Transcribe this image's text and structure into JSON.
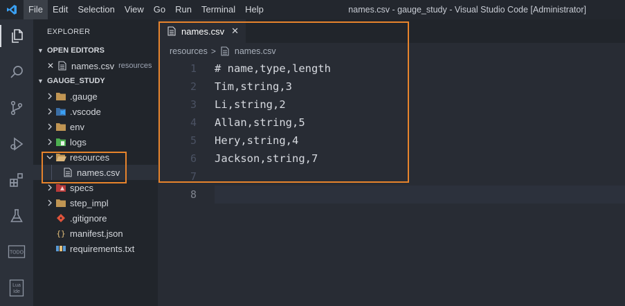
{
  "window": {
    "title": "names.csv - gauge_study - Visual Studio Code [Administrator]",
    "menu": [
      "File",
      "Edit",
      "Selection",
      "View",
      "Go",
      "Run",
      "Terminal",
      "Help"
    ]
  },
  "activity_bar": {
    "items": [
      "explorer-icon",
      "search-icon",
      "source-control-icon",
      "run-debug-icon",
      "extensions-icon",
      "testing-icon",
      "todo-icon",
      "lua-ide-icon"
    ],
    "todo_label": "TODO",
    "lua_label_1": "Lua",
    "lua_label_2": "Ide"
  },
  "sidebar": {
    "title": "EXPLORER",
    "open_editors": {
      "label": "OPEN EDITORS",
      "file": "names.csv",
      "folder": "resources"
    },
    "workspace": {
      "label": "GAUGE_STUDY",
      "items": [
        {
          "name": ".gauge",
          "kind": "folder",
          "expanded": false
        },
        {
          "name": ".vscode",
          "kind": "folder",
          "expanded": false
        },
        {
          "name": "env",
          "kind": "folder",
          "expanded": false
        },
        {
          "name": "logs",
          "kind": "folder",
          "expanded": false
        },
        {
          "name": "resources",
          "kind": "folder",
          "expanded": true
        },
        {
          "name": "names.csv",
          "kind": "file",
          "selected": true
        },
        {
          "name": "specs",
          "kind": "folder",
          "expanded": false
        },
        {
          "name": "step_impl",
          "kind": "folder",
          "expanded": false
        },
        {
          "name": ".gitignore",
          "kind": "file"
        },
        {
          "name": "manifest.json",
          "kind": "file"
        },
        {
          "name": "requirements.txt",
          "kind": "file"
        }
      ]
    }
  },
  "editor": {
    "tab": {
      "label": "names.csv",
      "close": "✕"
    },
    "breadcrumb": {
      "folder": "resources",
      "file": "names.csv"
    },
    "lines": [
      {
        "n": "1",
        "text": "# name,type,length"
      },
      {
        "n": "2",
        "text": "Tim,string,3"
      },
      {
        "n": "3",
        "text": "Li,string,2"
      },
      {
        "n": "4",
        "text": "Allan,string,5"
      },
      {
        "n": "5",
        "text": "Hery,string,4"
      },
      {
        "n": "6",
        "text": "Jackson,string,7"
      },
      {
        "n": "7",
        "text": ""
      },
      {
        "n": "8",
        "text": ""
      }
    ],
    "current_line": "8"
  },
  "colors": {
    "accent_highlight": "#e8842c",
    "folder": "#c09553",
    "editor_bg": "#282c34",
    "sidebar_bg": "#21252b"
  }
}
